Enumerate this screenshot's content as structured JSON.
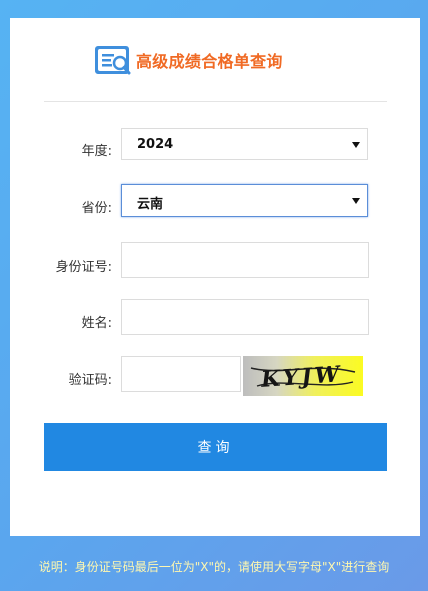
{
  "header": {
    "title": "高级成绩合格单查询"
  },
  "form": {
    "year_label": "年度:",
    "year_value": "2024",
    "province_label": "省份:",
    "province_value": "云南",
    "id_label": "身份证号:",
    "id_value": "",
    "name_label": "姓名:",
    "name_value": "",
    "captcha_label": "验证码:",
    "captcha_value": "",
    "captcha_image_text": "KYJW"
  },
  "actions": {
    "submit_label": "查询"
  },
  "footer": {
    "note": "说明：身份证号码最后一位为\"X\"的，请使用大写字母\"X\"进行查询"
  },
  "colors": {
    "title": "#f06a24",
    "button": "#2188e2",
    "note": "#fff8b0"
  }
}
